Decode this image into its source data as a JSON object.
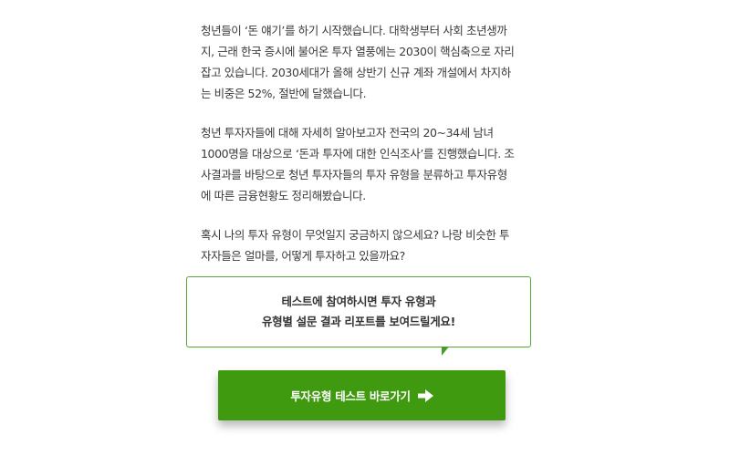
{
  "article": {
    "paragraphs": [
      {
        "lines": [
          "청년들이 ‘돈 얘기’를 하기 시작했습니다. 대학생부터 사회 초년생까",
          "지, 근래 한국 증시에 불어온 투자 열풍에는 2030이 핵심축으로 자리",
          "잡고 있습니다. 2030세대가 올해 상반기 신규 계좌 개설에서 차지하",
          "는 비중은 52%, 절반에 달했습니다."
        ]
      },
      {
        "lines": [
          "청년 투자자들에 대해 자세히 알아보고자 전국의 20~34세 남녀",
          "1000명을 대상으로 ‘돈과 투자에 대한 인식조사’를 진행했습니다. 조",
          "사결과를 바탕으로 청년 투자자들의 투자 유형을 분류하고 투자유형",
          "에 따른 금융현황도 정리해봤습니다."
        ]
      },
      {
        "lines": [
          "혹시 나의 투자 유형이 무엇일지 궁금하지 않으세요? 나랑 비슷한 투",
          "자자들은 얼마를, 어떻게 투자하고 있을까요?"
        ]
      }
    ]
  },
  "bubble": {
    "line1": "테스트에 참여하시면 투자 유형과",
    "line2": "유형별 설문 결과 리포트를 보여드릴게요!"
  },
  "cta": {
    "label": "투자유형 테스트 바로가기",
    "icon": "arrow-right-icon",
    "color": "#3f9a0f"
  },
  "colors": {
    "accent": "#3f9a0f",
    "bubble_border": "#5aa83a",
    "text": "#3a3a3a"
  }
}
